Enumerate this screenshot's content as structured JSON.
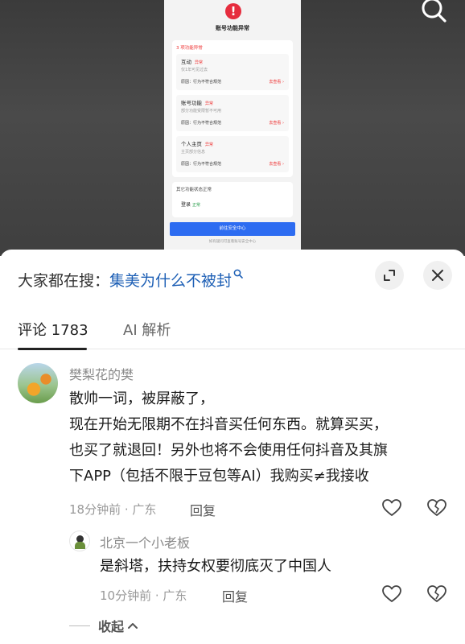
{
  "video": {
    "search_icon": "search-icon",
    "screenshot": {
      "title": "账号功能异常",
      "section": "3 项功能异常",
      "items": [
        {
          "title": "互动",
          "tag": "异常",
          "desc": "仅1年可见过去",
          "kind": "原因：行为不符合规范",
          "action": "去查看 ›"
        },
        {
          "title": "账号功能",
          "tag": "异常",
          "desc": "部分功能受限暂不可用",
          "kind": "原因：行为不符合规范",
          "action": "去查看 ›"
        },
        {
          "title": "个人主页",
          "tag": "异常",
          "desc": "主页部分信息",
          "kind": "原因：行为不符合规范",
          "action": "去查看 ›"
        }
      ],
      "other_section": "其它功能状态正常",
      "login_item": {
        "title": "登录",
        "tag": "正常"
      },
      "button": "前往安全中心",
      "footer": "如有疑问可查看账号安全中心"
    }
  },
  "search": {
    "prefix": "大家都在搜：",
    "query": "集美为什么不被封",
    "icon": "search-icon"
  },
  "tabs": [
    {
      "label": "评论 1783",
      "active": true
    },
    {
      "label": "AI 解析",
      "active": false
    }
  ],
  "comments": [
    {
      "username": "樊梨花的樊",
      "text": [
        "散帅一词，被屏蔽了，",
        "现在开始无限期不在抖音买任何东西。就算买买，",
        "也买了就退回！另外也将不会使用任何抖音及其旗",
        "下APP（包括不限于豆包等AI）我购买≠我接收"
      ],
      "meta": "18分钟前 · 广东",
      "reply": "回复"
    },
    {
      "username": "北京一个小老板",
      "text": [
        "是斜塔，扶持女权要彻底灭了中国人"
      ],
      "meta": "10分钟前 · 广东",
      "reply": "回复"
    }
  ],
  "collapse_label": "收起",
  "colors": {
    "accent_blue": "#1d5fb5",
    "warning_red": "#e62d3e",
    "button_blue": "#2d6cf1"
  }
}
